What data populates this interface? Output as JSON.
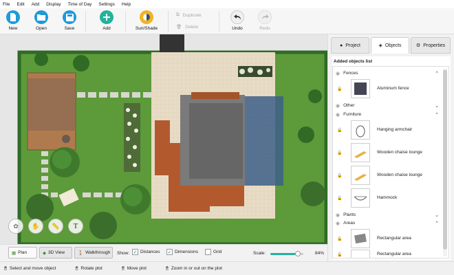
{
  "menu": [
    "File",
    "Edit",
    "Add",
    "Display",
    "Time of Day",
    "Settings",
    "Help"
  ],
  "toolbar": {
    "new": "New",
    "open": "Open",
    "save": "Save",
    "add": "Add",
    "sun_shade": "Sun/Shade",
    "duplicate": "Duplicate",
    "delete": "Delete",
    "undo": "Undo",
    "redo": "Redo"
  },
  "panel": {
    "tabs": [
      "Project",
      "Objects",
      "Properties"
    ],
    "active_tab": "Objects",
    "list_title": "Added objects list",
    "categories": {
      "fences": "Fences",
      "other": "Other",
      "furniture": "Furniture",
      "plants": "Plants",
      "areas": "Areas"
    },
    "items": {
      "aluminum_fence": "Aluminum fence",
      "hanging_armchair": "Hanging armchair",
      "chaise_1": "Wooden chaise lounge",
      "chaise_2": "Wooden chaise lounge",
      "hammock": "Hammock",
      "rect_area_1": "Rectangular area",
      "rect_area_2": "Rectangular area"
    }
  },
  "bottom": {
    "views": [
      "Plan",
      "3D View",
      "Walkthrough"
    ],
    "active_view": "Plan",
    "show_label": "Show:",
    "distances": "Distances",
    "dimensions": "Dimensions",
    "grid": "Grid",
    "distances_checked": true,
    "dimensions_checked": true,
    "grid_checked": false,
    "scale_label": "Scale:",
    "scale_value": "84%",
    "scale_fraction": 0.84
  },
  "status": {
    "select": "Select and move object",
    "rotate": "Rotate plot",
    "move": "Move plot",
    "zoom": "Zoom in or out on the plot"
  },
  "colors": {
    "accent": "#1e9bd7",
    "grass": "#5d9a3a",
    "add_button": "#22b39b",
    "sun_button": "#f2b321"
  }
}
